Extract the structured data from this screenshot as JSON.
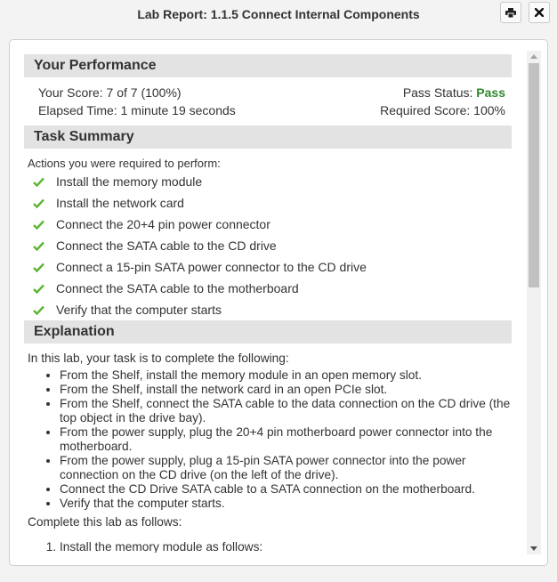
{
  "window": {
    "title": "Lab Report: 1.1.5 Connect Internal Components",
    "print_icon": "printer-icon",
    "close_icon": "close-icon"
  },
  "performance": {
    "heading": "Your Performance",
    "score": "Your Score: 7 of 7 (100%)",
    "elapsed": "Elapsed Time: 1 minute 19 seconds",
    "pass_label": "Pass Status:",
    "pass_value": "Pass",
    "required": "Required Score: 100%"
  },
  "task_summary": {
    "heading": "Task Summary",
    "intro": "Actions you were required to perform:",
    "items": [
      {
        "label": "Install the memory module"
      },
      {
        "label": "Install the network card"
      },
      {
        "label": "Connect the 20+4 pin power connector"
      },
      {
        "label": "Connect the SATA cable to the CD drive"
      },
      {
        "label": "Connect a 15-pin SATA power connector to the CD drive"
      },
      {
        "label": "Connect the SATA cable to the motherboard"
      },
      {
        "label": "Verify that the computer starts"
      }
    ]
  },
  "explanation": {
    "heading": "Explanation",
    "intro": "In this lab, your task is to complete the following:",
    "bullets": [
      "From the Shelf, install the memory module in an open memory slot.",
      "From the Shelf, install the network card in an open PCIe slot.",
      "From the Shelf, connect the SATA cable to the data connection on the CD drive (the top object in the drive bay).",
      "From the power supply, plug the 20+4 pin motherboard power connector into the motherboard.",
      "From the power supply, plug a 15-pin SATA power connector into the power connection on the CD drive (on the left of the drive).",
      "Connect the CD Drive SATA cable to a SATA connection on the motherboard.",
      "Verify that the computer starts."
    ],
    "steps_intro": "Complete this lab as follows:",
    "steps": [
      "Install the memory module as follows:"
    ]
  },
  "colors": {
    "pass": "#2e8a2e",
    "check": "#5cb531",
    "section_header_bg": "#e3e3e3"
  }
}
